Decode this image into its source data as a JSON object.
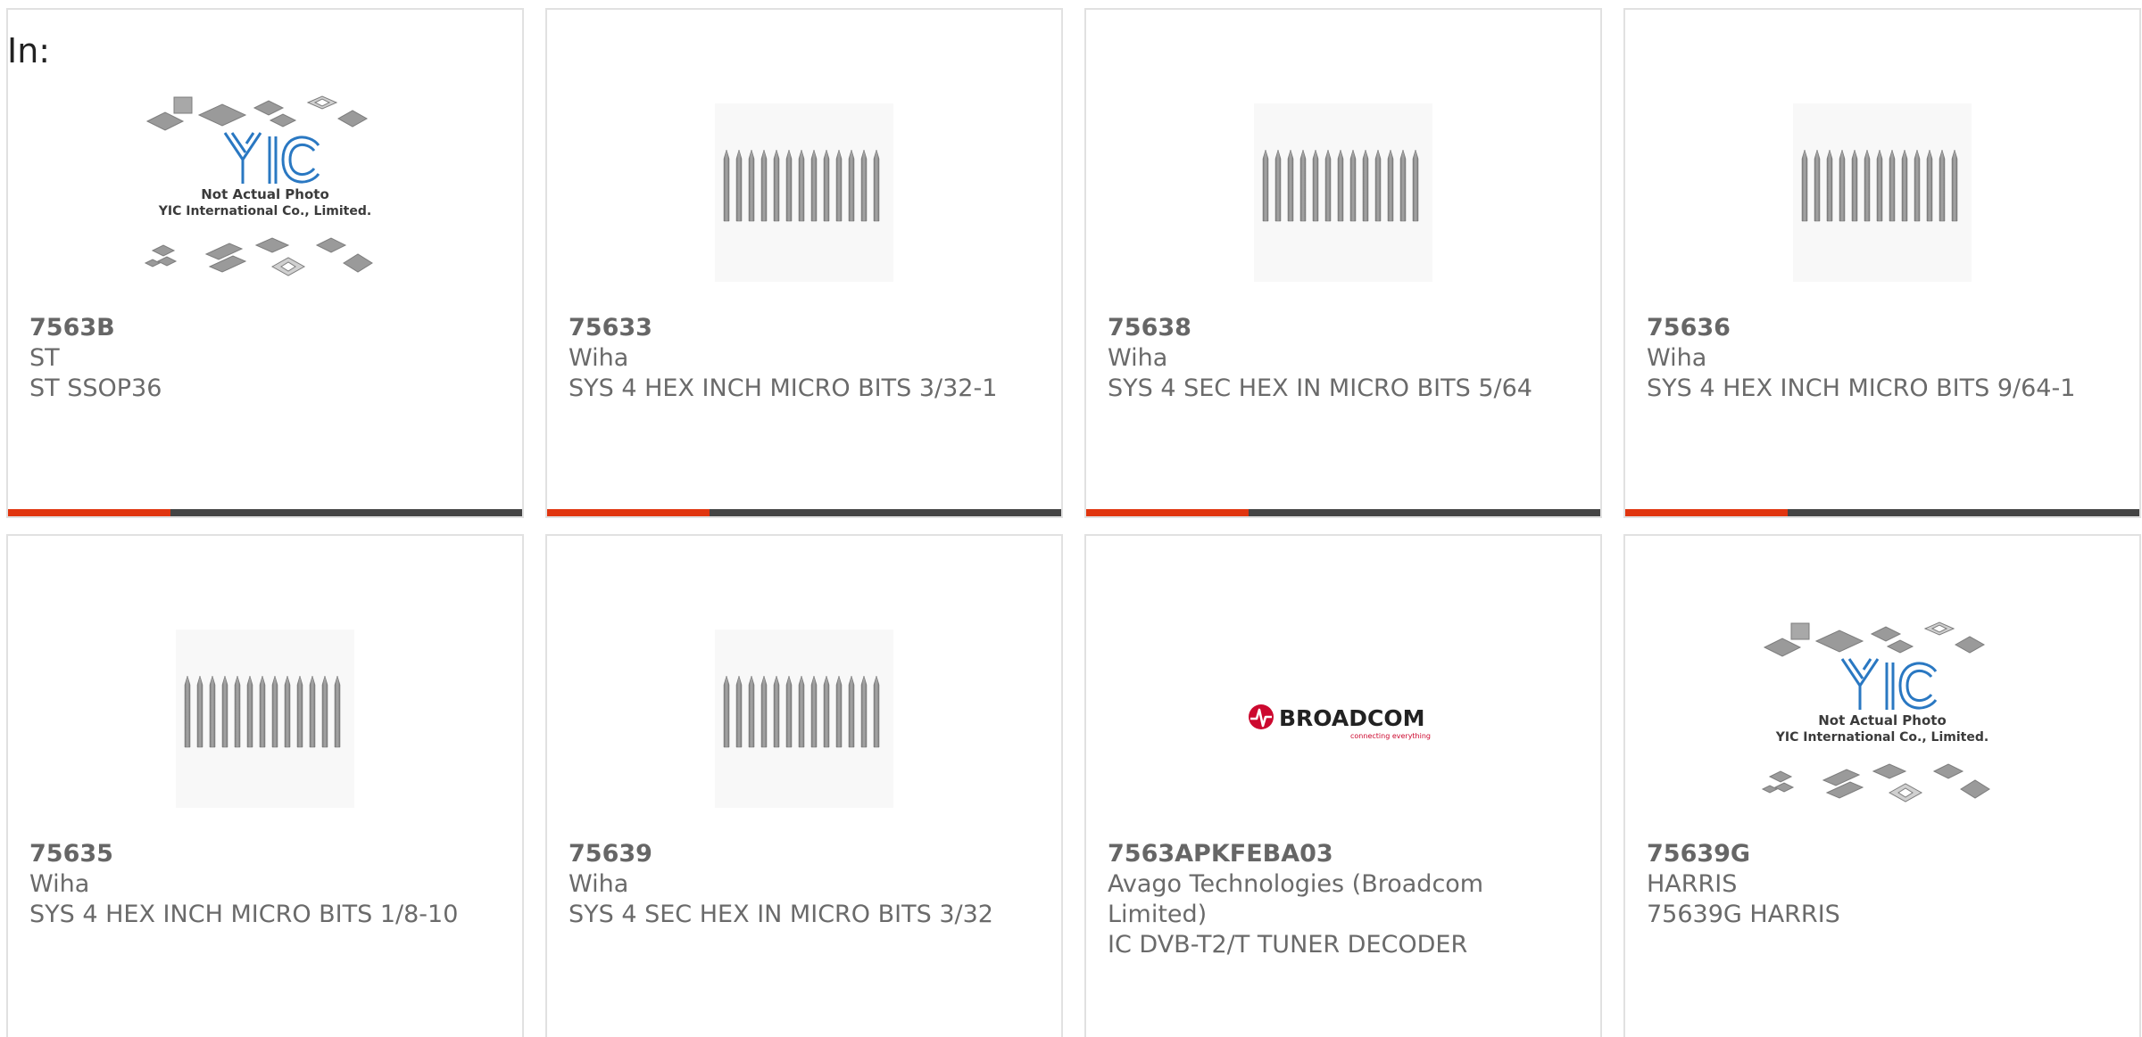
{
  "page": {
    "heading": "In:"
  },
  "placeholder_image": {
    "line1": "Not Actual Photo",
    "line2": "YIC International Co., Limited.",
    "logo": "YIC"
  },
  "broadcom_image": {
    "brand": "BROADCOM",
    "tagline": "connecting everything"
  },
  "colors": {
    "accent": "#e0350f",
    "bar": "#444444",
    "text": "#6a6a6a",
    "border": "#e1e1e1"
  },
  "products": [
    {
      "part_number": "7563B",
      "manufacturer": "ST",
      "description": "ST SSOP36",
      "image": "placeholder-chips-icon"
    },
    {
      "part_number": "75633",
      "manufacturer": "Wiha",
      "description": "SYS 4 HEX INCH MICRO BITS 3/32-1",
      "image": "micro-bits-icon"
    },
    {
      "part_number": "75638",
      "manufacturer": "Wiha",
      "description": "SYS 4 SEC HEX IN MICRO BITS 5/64",
      "image": "micro-bits-icon"
    },
    {
      "part_number": "75636",
      "manufacturer": "Wiha",
      "description": "SYS 4 HEX INCH MICRO BITS 9/64-1",
      "image": "micro-bits-icon"
    },
    {
      "part_number": "75635",
      "manufacturer": "Wiha",
      "description": "SYS 4 HEX INCH MICRO BITS 1/8-10",
      "image": "micro-bits-icon"
    },
    {
      "part_number": "75639",
      "manufacturer": "Wiha",
      "description": "SYS 4 SEC HEX IN MICRO BITS 3/32",
      "image": "micro-bits-icon"
    },
    {
      "part_number": "7563APKFEBA03",
      "manufacturer": "Avago Technologies (Broadcom Limited)",
      "description": "IC DVB-T2/T TUNER DECODER",
      "image": "broadcom-logo-icon"
    },
    {
      "part_number": "75639G",
      "manufacturer": "HARRIS",
      "description": "75639G HARRIS",
      "image": "placeholder-chips-icon"
    }
  ]
}
